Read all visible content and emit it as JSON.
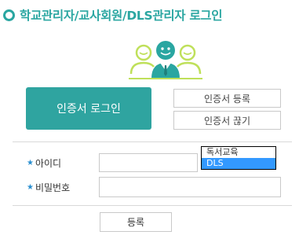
{
  "header": {
    "title": "학교관리자/교사회원/DLS관리자 로그인"
  },
  "icons": {
    "title": "ring-bullet-icon",
    "users": "user-group-icon",
    "required": "star-icon"
  },
  "buttons": {
    "cert_login": "인증서 로그인",
    "cert_register": "인증서 등록",
    "cert_copy": "인증서 끊기",
    "register": "등록"
  },
  "form": {
    "id_label": "아이디",
    "password_label": "비밀번호",
    "id_value": "",
    "password_value": "",
    "required_marker": "★"
  },
  "dropdown": {
    "options": [
      "독서교육",
      "DLS"
    ],
    "selected": "DLS"
  },
  "colors": {
    "accent": "#2aa6a1",
    "button": "#2fa4a0",
    "selected_option": "#3399ff",
    "star": "#2a8fd0"
  }
}
